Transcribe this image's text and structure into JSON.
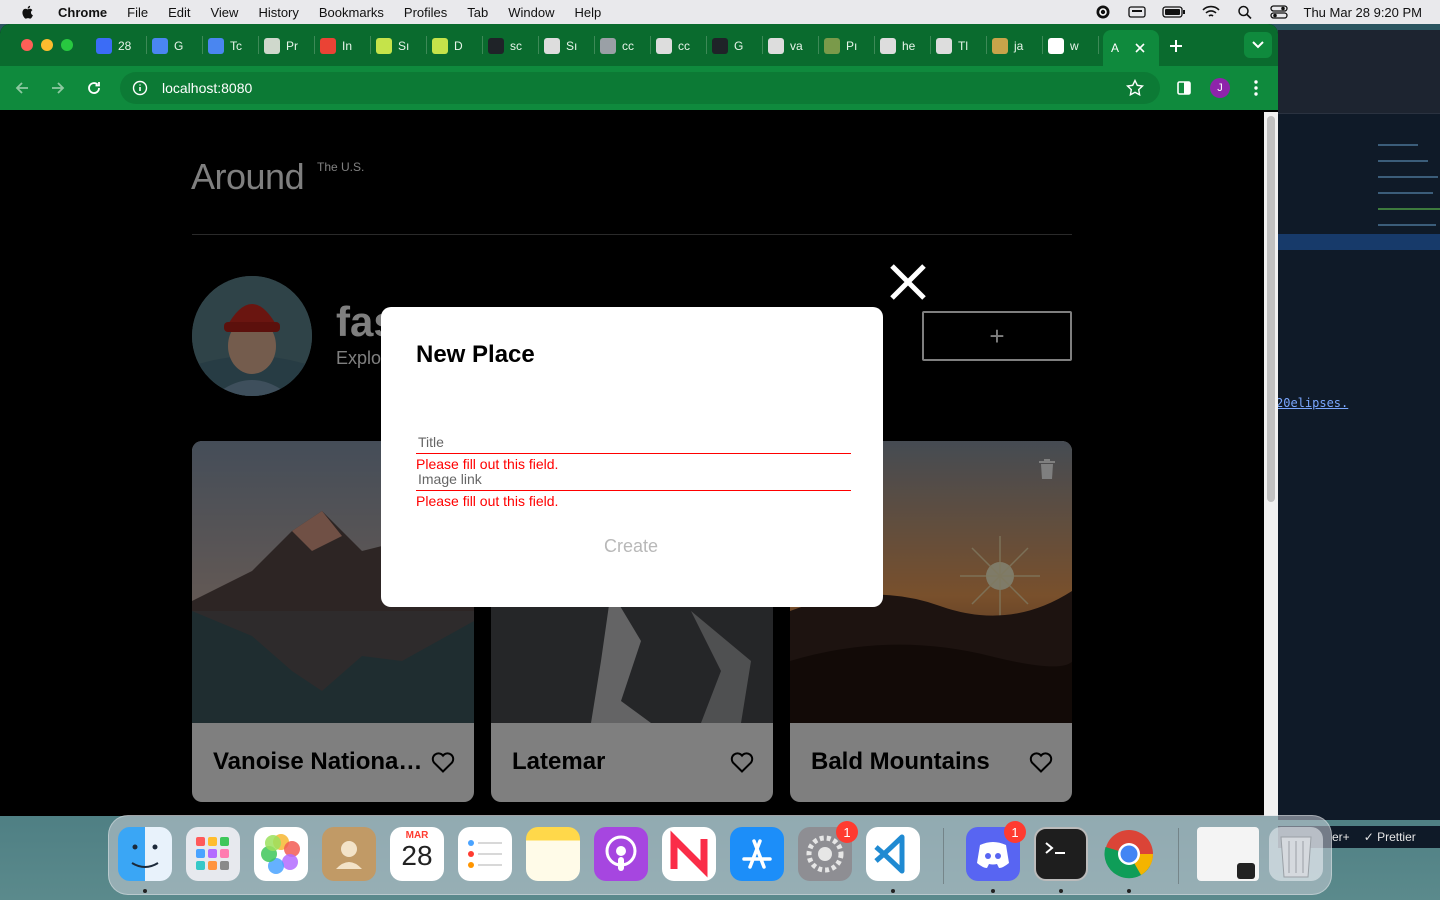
{
  "menubar": {
    "app": "Chrome",
    "items": [
      "File",
      "Edit",
      "View",
      "History",
      "Bookmarks",
      "Profiles",
      "Tab",
      "Window",
      "Help"
    ],
    "clock": "Thu Mar 28  9:20 PM"
  },
  "browser": {
    "tabs": [
      {
        "label": "28",
        "icon": "bitwarden-icon",
        "color": "#3b6cf6"
      },
      {
        "label": "G",
        "icon": "docs-icon",
        "color": "#4a86f0"
      },
      {
        "label": "Tc",
        "icon": "docs-icon",
        "color": "#4a86f0"
      },
      {
        "label": "Pr",
        "icon": "wrench-icon",
        "color": "#cfd8cc"
      },
      {
        "label": "In",
        "icon": "gmail-icon",
        "color": "#ea4335"
      },
      {
        "label": "Sı",
        "icon": "dev-icon",
        "color": "#c5e34a"
      },
      {
        "label": "D",
        "icon": "dev-icon",
        "color": "#c5e34a"
      },
      {
        "label": "sc",
        "icon": "github-icon",
        "color": "#1f2328"
      },
      {
        "label": "Sı",
        "icon": "gear-tab-icon",
        "color": "#dddddd"
      },
      {
        "label": "cc",
        "icon": "globe-icon",
        "color": "#9aa0a6"
      },
      {
        "label": "cc",
        "icon": "openai-icon",
        "color": "#dddddd"
      },
      {
        "label": "G",
        "icon": "github-icon",
        "color": "#1f2328"
      },
      {
        "label": "va",
        "icon": "openai-icon",
        "color": "#dddddd"
      },
      {
        "label": "Pı",
        "icon": "tab-icon",
        "color": "#7a9a4a"
      },
      {
        "label": "he",
        "icon": "openai-icon",
        "color": "#dddddd"
      },
      {
        "label": "Tl",
        "icon": "tab-icon",
        "color": "#dddddd"
      },
      {
        "label": "ja",
        "icon": "tab-icon",
        "color": "#c8a44a"
      },
      {
        "label": "w",
        "icon": "google-icon",
        "color": "#ffffff"
      }
    ],
    "active_tab": "A",
    "url": "localhost:8080"
  },
  "page": {
    "logo": "Around",
    "logo_sup": "The U.S.",
    "profile_name": "fas",
    "profile_job": "Explo",
    "add_button": "+",
    "cards": [
      {
        "title": "Vanoise Nationa…"
      },
      {
        "title": "Latemar"
      },
      {
        "title": "Bald Mountains"
      }
    ]
  },
  "modal": {
    "title": "New Place",
    "title_placeholder": "Title",
    "title_error": "Please fill out this field.",
    "link_placeholder": "Image link",
    "link_error": "Please fill out this field.",
    "submit": "Create"
  },
  "background_window": {
    "link_text": "20elipses.",
    "status_left": "er+",
    "status_right": "✓ Prettier"
  },
  "dock": {
    "calendar_month": "MAR",
    "calendar_day": "28",
    "settings_badge": "1",
    "discord_badge": "1"
  },
  "colors": {
    "chrome_green": "#0f8a3d",
    "error_red": "#ff0000",
    "page_bg": "#000000"
  }
}
